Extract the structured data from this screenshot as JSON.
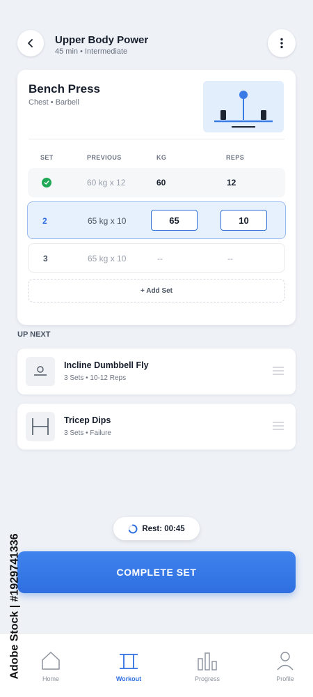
{
  "header": {
    "title": "Upper Body Power",
    "subtitle": "45 min • Intermediate",
    "back_icon": "chevron-left-icon",
    "menu_icon": "more-vertical-icon"
  },
  "exercise": {
    "name": "Bench Press",
    "meta": "Chest • Barbell",
    "thumbnail_icon": "barbell-icon",
    "columns": {
      "set": "SET",
      "previous": "PREVIOUS",
      "kg": "KG",
      "reps": "REPS"
    },
    "sets": [
      {
        "set": "",
        "status_icon": "check-circle-icon",
        "previous": "60 kg x 12",
        "kg": "60",
        "reps": "12"
      },
      {
        "set": "2",
        "previous": "65 kg x 10",
        "kg": "65",
        "reps": "10"
      },
      {
        "set": "3",
        "previous": "65 kg x 10",
        "kg": "--",
        "reps": "--"
      }
    ],
    "add_set_label": "+ Add Set"
  },
  "up_next": {
    "label": "UP NEXT",
    "items": [
      {
        "title": "Incline Dumbbell Fly",
        "meta": "3 Sets • 10-12 Reps",
        "icon": "bench-icon"
      },
      {
        "title": "Tricep Dips",
        "meta": "3 Sets • Failure",
        "icon": "dip-bars-icon"
      }
    ]
  },
  "rest": {
    "label": "Rest: 00:45",
    "icon": "timer-ring-icon"
  },
  "complete_button": "COMPLETE SET",
  "nav": {
    "items": [
      {
        "label": "Home",
        "icon": "home-icon"
      },
      {
        "label": "Workout",
        "icon": "workout-icon",
        "active": true
      },
      {
        "label": "Progress",
        "icon": "bar-chart-icon"
      },
      {
        "label": "Profile",
        "icon": "user-icon"
      }
    ]
  },
  "watermark": "Adobe Stock | #1929741336",
  "colors": {
    "accent": "#2f6fe0",
    "success": "#1fa855",
    "background": "#eef1f6",
    "active_row": "#e7f0fd"
  }
}
